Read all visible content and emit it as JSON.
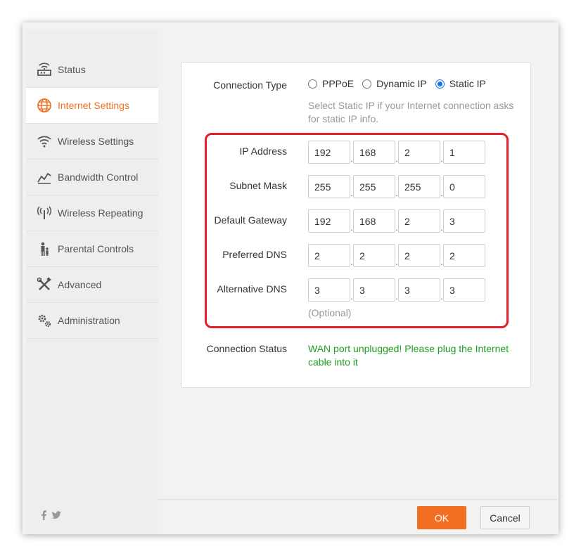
{
  "sidebar": {
    "items": [
      {
        "label": "Status",
        "icon": "router-icon"
      },
      {
        "label": "Internet Settings",
        "icon": "globe-icon",
        "active": true
      },
      {
        "label": "Wireless Settings",
        "icon": "wifi-icon"
      },
      {
        "label": "Bandwidth Control",
        "icon": "bandwidth-icon"
      },
      {
        "label": "Wireless Repeating",
        "icon": "repeater-icon"
      },
      {
        "label": "Parental Controls",
        "icon": "family-icon"
      },
      {
        "label": "Advanced",
        "icon": "tools-icon"
      },
      {
        "label": "Administration",
        "icon": "gears-icon"
      }
    ],
    "social": [
      "facebook-icon",
      "twitter-icon"
    ]
  },
  "form": {
    "connection_type_label": "Connection Type",
    "options": [
      "PPPoE",
      "Dynamic IP",
      "Static IP"
    ],
    "selected": "Static IP",
    "hint": "Select Static IP if your Internet connection asks for static IP info.",
    "fields": [
      {
        "label": "IP Address",
        "values": [
          "192",
          "168",
          "2",
          "1"
        ]
      },
      {
        "label": "Subnet Mask",
        "values": [
          "255",
          "255",
          "255",
          "0"
        ]
      },
      {
        "label": "Default Gateway",
        "values": [
          "192",
          "168",
          "2",
          "3"
        ]
      },
      {
        "label": "Preferred DNS",
        "values": [
          "2",
          "2",
          "2",
          "2"
        ]
      },
      {
        "label": "Alternative DNS",
        "values": [
          "3",
          "3",
          "3",
          "3"
        ]
      }
    ],
    "optional_note": "(Optional)",
    "connection_status_label": "Connection Status",
    "connection_status_text": "WAN port unplugged! Please plug the Internet cable into it"
  },
  "buttons": {
    "ok": "OK",
    "cancel": "Cancel"
  },
  "colors": {
    "accent": "#f26f21",
    "status_ok": "#1e9e1e",
    "highlight": "#e0202b",
    "radio_selected": "#1a73e8"
  }
}
